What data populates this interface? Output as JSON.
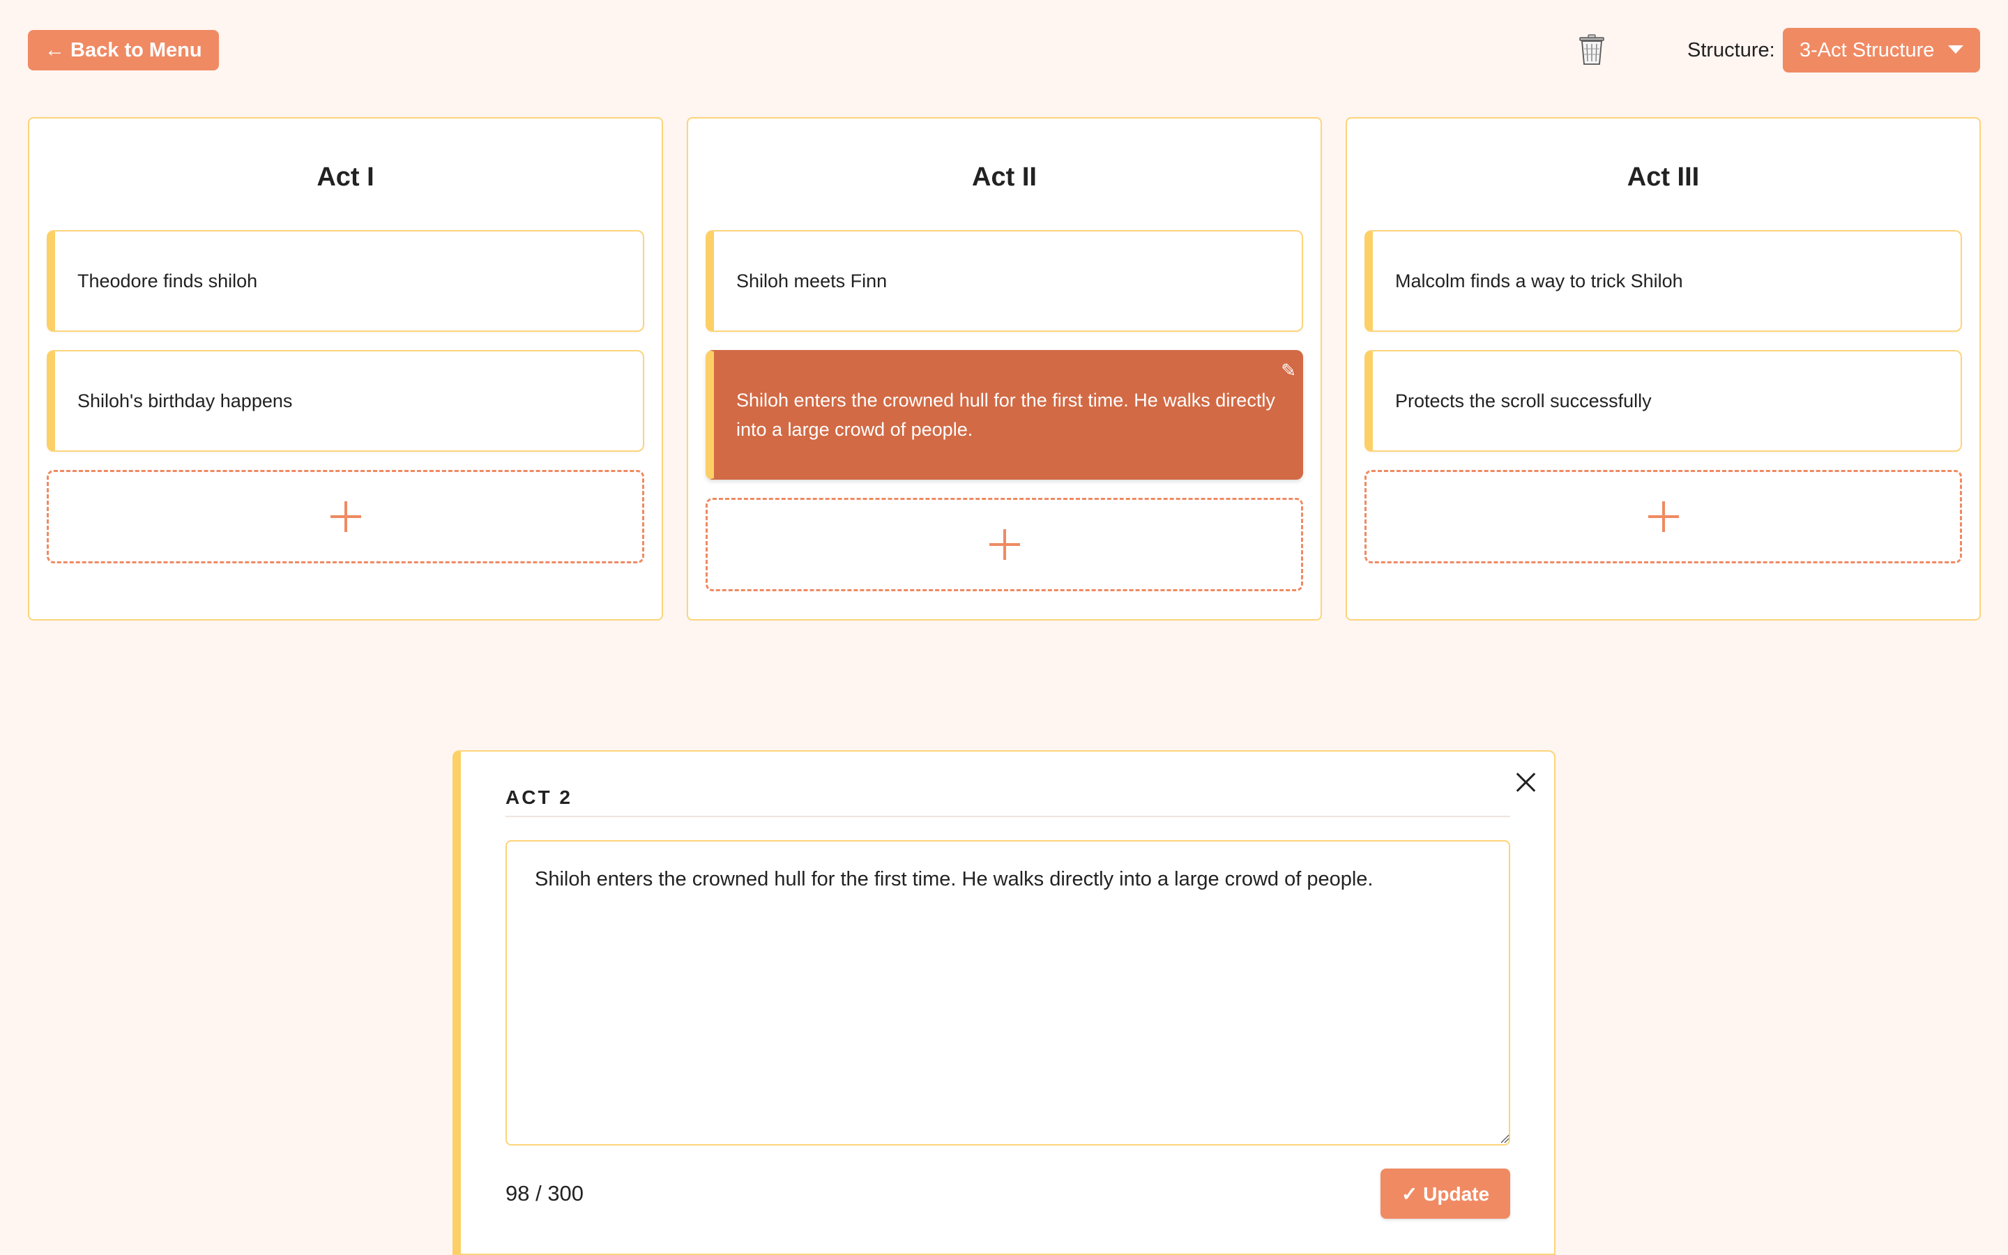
{
  "header": {
    "back_label": "← Back to Menu",
    "trash_icon": "trash-icon",
    "structure_label": "Structure:",
    "structure_value": "3-Act Structure"
  },
  "acts": [
    {
      "title": "Act I",
      "cards": [
        {
          "text": "Theodore finds shiloh"
        },
        {
          "text": "Shiloh's birthday happens"
        }
      ]
    },
    {
      "title": "Act II",
      "cards": [
        {
          "text": "Shiloh meets Finn"
        },
        {
          "text": "Shiloh enters the crowned hull for the first time. He walks directly into a large crowd of people.",
          "selected": true
        }
      ]
    },
    {
      "title": "Act III",
      "cards": [
        {
          "text": "Malcolm finds a way to trick Shiloh"
        },
        {
          "text": "Protects the scroll successfully"
        }
      ]
    }
  ],
  "editor": {
    "heading": "ACT 2",
    "text": "Shiloh enters the crowned hull for the first time. He walks directly into a large crowd of people.",
    "char_count": "98 / 300",
    "update_label": "✓ Update"
  },
  "colors": {
    "background": "#fff5f1",
    "accent": "#f08a63",
    "selected_card": "#d26a45",
    "border_yellow": "#fcd47a",
    "card_stripe": "#fcd066"
  }
}
